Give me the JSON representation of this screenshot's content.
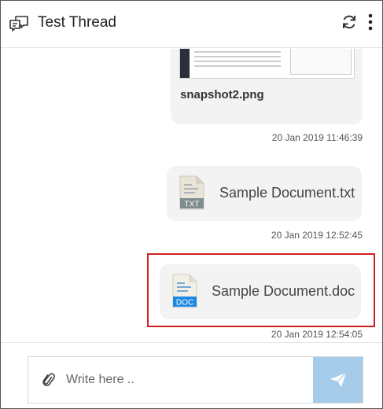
{
  "header": {
    "title": "Test Thread",
    "icons": {
      "thread": "chat-bubbles-icon",
      "refresh": "refresh-icon",
      "more": "more-vertical-icon"
    }
  },
  "messages": [
    {
      "type": "image",
      "file_name": "snapshot2.png",
      "timestamp": "20 Jan 2019 11:46:39"
    },
    {
      "type": "file",
      "file_type": "TXT",
      "file_name": "Sample Document.txt",
      "timestamp": "20 Jan 2019 12:52:45"
    },
    {
      "type": "file",
      "file_type": "DOC",
      "file_name": "Sample Document.doc",
      "timestamp": "20 Jan 2019 12:54:05",
      "highlighted": true
    }
  ],
  "composer": {
    "placeholder": "Write here ..",
    "value": "",
    "icons": {
      "attach": "paperclip-icon",
      "send": "paper-plane-icon"
    }
  },
  "colors": {
    "bubble": "#f3f3f3",
    "send_button": "#a6cbe9",
    "highlight": "#d02020",
    "txt_badge": "#7f8c8d",
    "doc_badge": "#1e88e5"
  }
}
